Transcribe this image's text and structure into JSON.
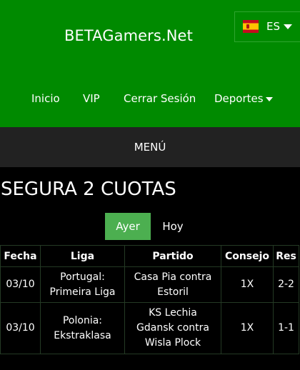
{
  "header": {
    "site_title": "BETAGamers.Net",
    "language": "ES",
    "flag_icon": "spain-flag-icon",
    "brand_color": "#008a00"
  },
  "nav": {
    "items": [
      {
        "label": "Inicio"
      },
      {
        "label": "VIP"
      },
      {
        "label": "Cerrar Sesión"
      },
      {
        "label": "Deportes"
      }
    ]
  },
  "menu": {
    "label": "MENÚ"
  },
  "page": {
    "title": "SEGURA 2 CUOTAS"
  },
  "tabs": [
    {
      "label": "Ayer",
      "active": true
    },
    {
      "label": "Hoy",
      "active": false
    }
  ],
  "table": {
    "columns": [
      "Fecha",
      "Liga",
      "Partido",
      "Consejo",
      "Res"
    ],
    "rows": [
      {
        "fecha": "03/10",
        "liga_line1": "Portugal:",
        "liga_line2": "Primeira Liga",
        "partido_line1": "Casa Pia contra",
        "partido_line2": "Estoril",
        "partido_line3": "",
        "consejo": "1X",
        "res": "2-2"
      },
      {
        "fecha": "03/10",
        "liga_line1": "Polonia:",
        "liga_line2": "Ekstraklasa",
        "partido_line1": "KS Lechia",
        "partido_line2": "Gdansk contra",
        "partido_line3": "Wisla Plock",
        "consejo": "1X",
        "res": "1-1"
      }
    ]
  }
}
